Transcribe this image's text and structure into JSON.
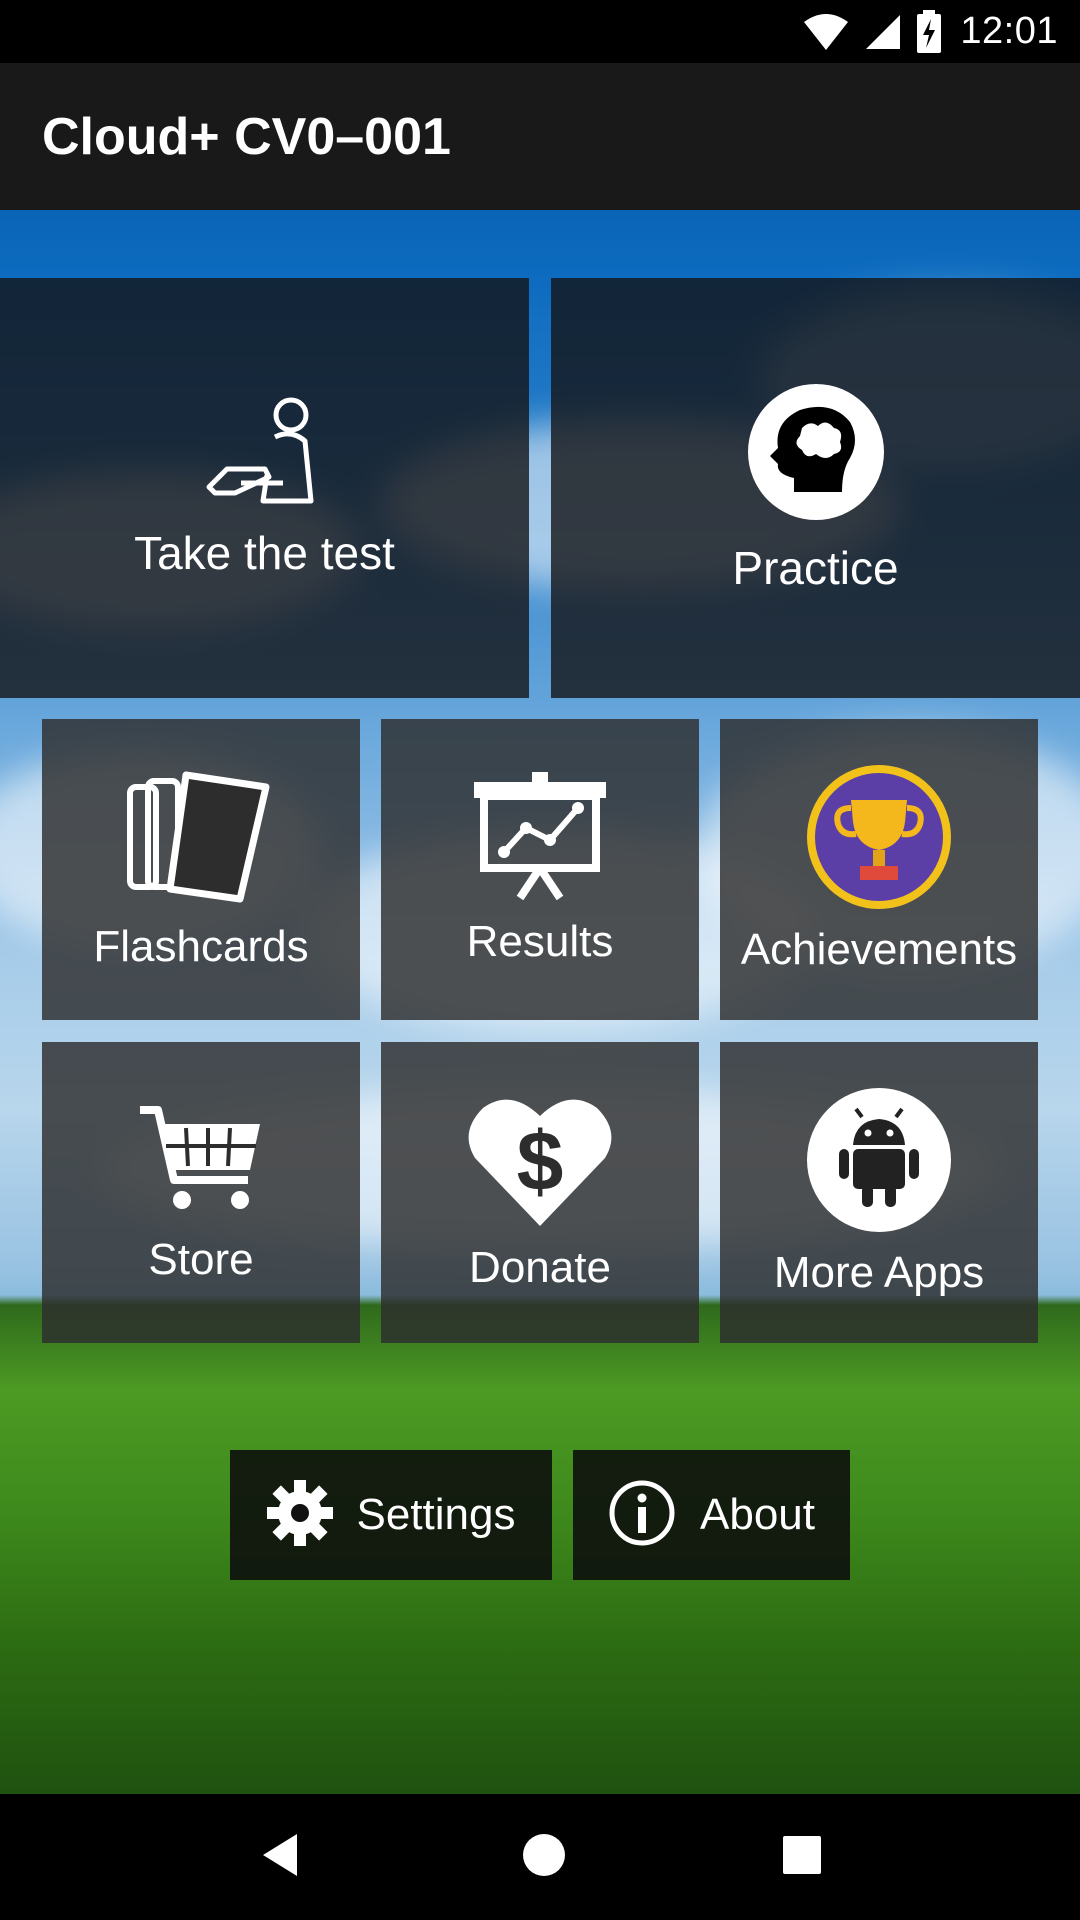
{
  "status_bar": {
    "time": "12:01",
    "icons": [
      "wifi-icon",
      "signal-icon",
      "battery-charging-icon"
    ]
  },
  "app_bar": {
    "title": "Cloud+ CV0–001"
  },
  "main_tiles": [
    {
      "label": "Take the test",
      "icon": "test-taker-icon"
    },
    {
      "label": "Practice",
      "icon": "brain-head-icon"
    }
  ],
  "grid_tiles": [
    {
      "label": "Flashcards",
      "icon": "flashcards-icon"
    },
    {
      "label": "Results",
      "icon": "chart-presentation-icon"
    },
    {
      "label": "Achievements",
      "icon": "trophy-icon"
    },
    {
      "label": "Store",
      "icon": "cart-icon"
    },
    {
      "label": "Donate",
      "icon": "dollar-heart-icon"
    },
    {
      "label": "More Apps",
      "icon": "android-icon"
    }
  ],
  "bottom_buttons": [
    {
      "label": "Settings",
      "icon": "gear-icon"
    },
    {
      "label": "About",
      "icon": "info-icon"
    }
  ],
  "nav_bar": {
    "icons": [
      "back-icon",
      "home-icon",
      "recents-icon"
    ]
  },
  "colors": {
    "trophy_circle": "#5b3fa6",
    "trophy_ring": "#f2c21b",
    "trophy_gold": "#f5b81c"
  }
}
